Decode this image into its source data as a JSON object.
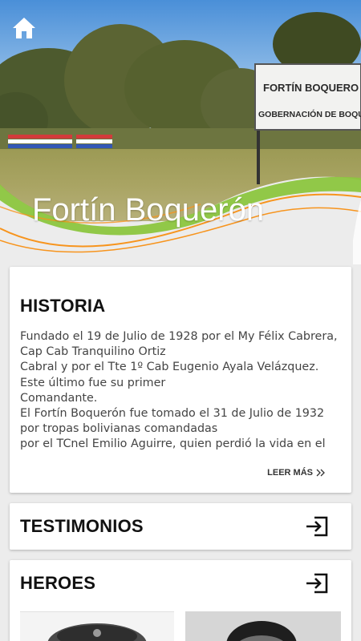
{
  "hero": {
    "title": "Fortín Boquerón",
    "sign_line1": "FORTÍN BOQUERO",
    "sign_line2": "GOBERNACIÓN DE BOQUE"
  },
  "historia": {
    "title": "HISTORIA",
    "lines": [
      "Fundado el 19 de Julio de 1928 por el My Félix Cabrera,",
      "Cap Cab Tranquilino Ortiz",
      "Cabral y por el Tte 1º Cab Eugenio Ayala Velázquez.",
      "Este último fue su primer",
      "Comandante.",
      "El Fortín Boquerón fue tomado el 31 de Julio de 1932",
      "por tropas bolivianas comandadas",
      "por el TCnel Emilio Aguirre, quien perdió la vida en el"
    ],
    "read_more": "LEER MÁS"
  },
  "testimonios": {
    "title": "TESTIMONIOS"
  },
  "heroes": {
    "title": "HEROES"
  },
  "colors": {
    "green_wave": "#8cc63f",
    "orange_wave": "#f7941d",
    "title_text": "#111111",
    "body_text": "#444444"
  },
  "icons": {
    "home": "home-icon",
    "enter": "enter-icon",
    "double_chevron": "double-chevron-right-icon"
  }
}
